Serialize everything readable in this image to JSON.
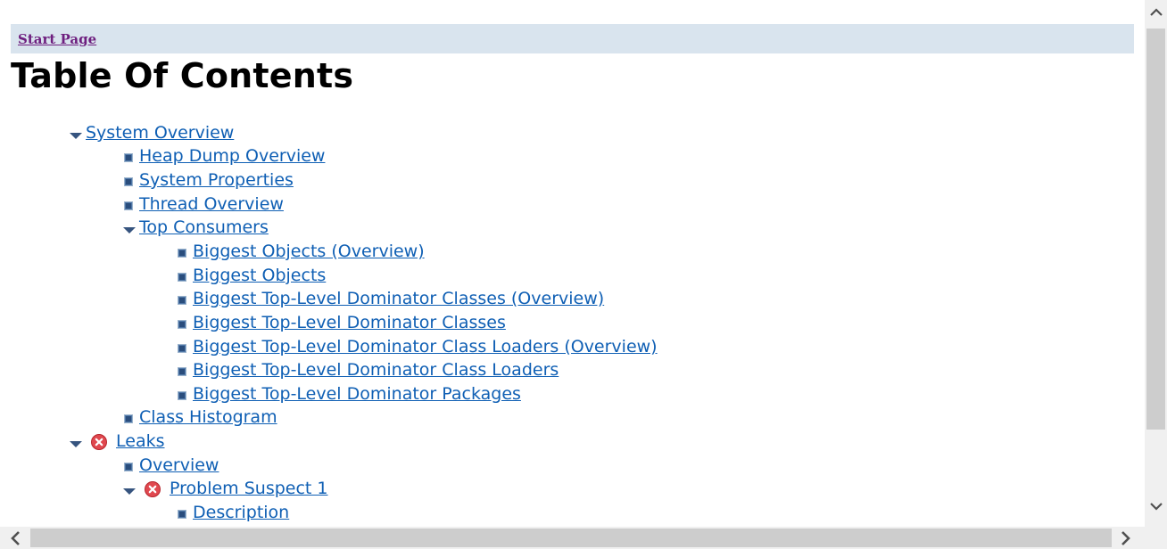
{
  "breadcrumb": {
    "start_page": "Start Page"
  },
  "title": "Table Of Contents",
  "toc": {
    "system_overview": "System Overview",
    "heap_dump_overview": "Heap Dump Overview",
    "system_properties": "System Properties",
    "thread_overview": "Thread Overview",
    "top_consumers": "Top Consumers",
    "biggest_objects_overview": "Biggest Objects (Overview)",
    "biggest_objects": "Biggest Objects",
    "biggest_tl_dom_classes_overview": "Biggest Top-Level Dominator Classes (Overview)",
    "biggest_tl_dom_classes": "Biggest Top-Level Dominator Classes",
    "biggest_tl_dom_class_loaders_overview": "Biggest Top-Level Dominator Class Loaders (Overview)",
    "biggest_tl_dom_class_loaders": "Biggest Top-Level Dominator Class Loaders",
    "biggest_tl_dom_packages": "Biggest Top-Level Dominator Packages",
    "class_histogram": "Class Histogram",
    "leaks": "Leaks",
    "overview": "Overview",
    "problem_suspect_1": "Problem Suspect 1",
    "description": "Description"
  },
  "icons": {
    "expanded": "triangle-down-icon",
    "leaf": "square-bullet-icon",
    "error": "error-x-icon"
  },
  "colors": {
    "link": "#0f5fb4",
    "visited_link": "#6e1f7f",
    "breadcrumb_bg": "#d9e4ee",
    "error_red": "#e0484f"
  }
}
